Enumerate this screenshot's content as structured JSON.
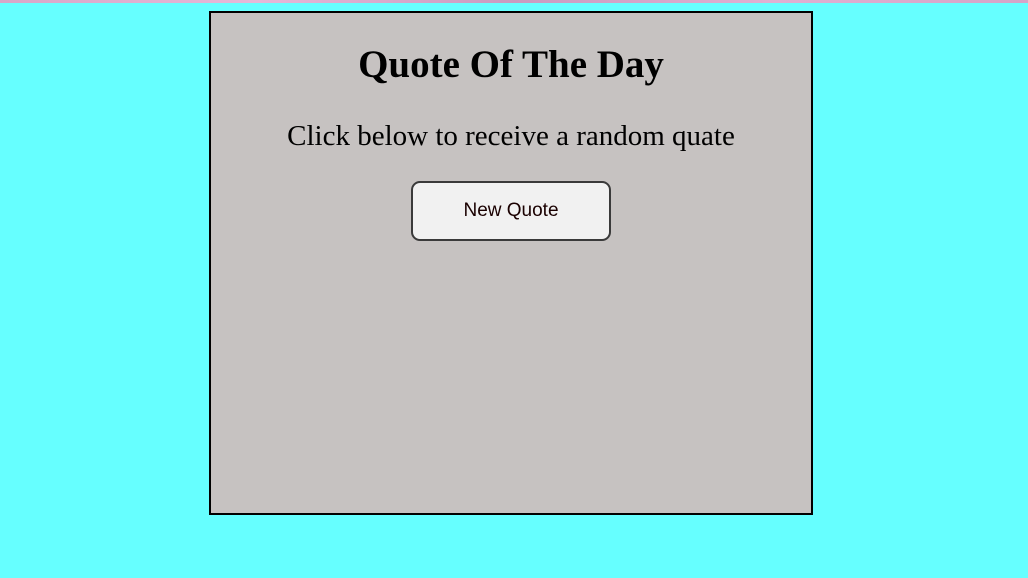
{
  "card": {
    "title": "Quote Of The Day",
    "subtitle": "Click below to receive a random quate",
    "button_label": "New Quote"
  },
  "colors": {
    "page_background": "#66ffff",
    "card_background": "#c6c2c1",
    "button_background": "#f1f1f1"
  }
}
